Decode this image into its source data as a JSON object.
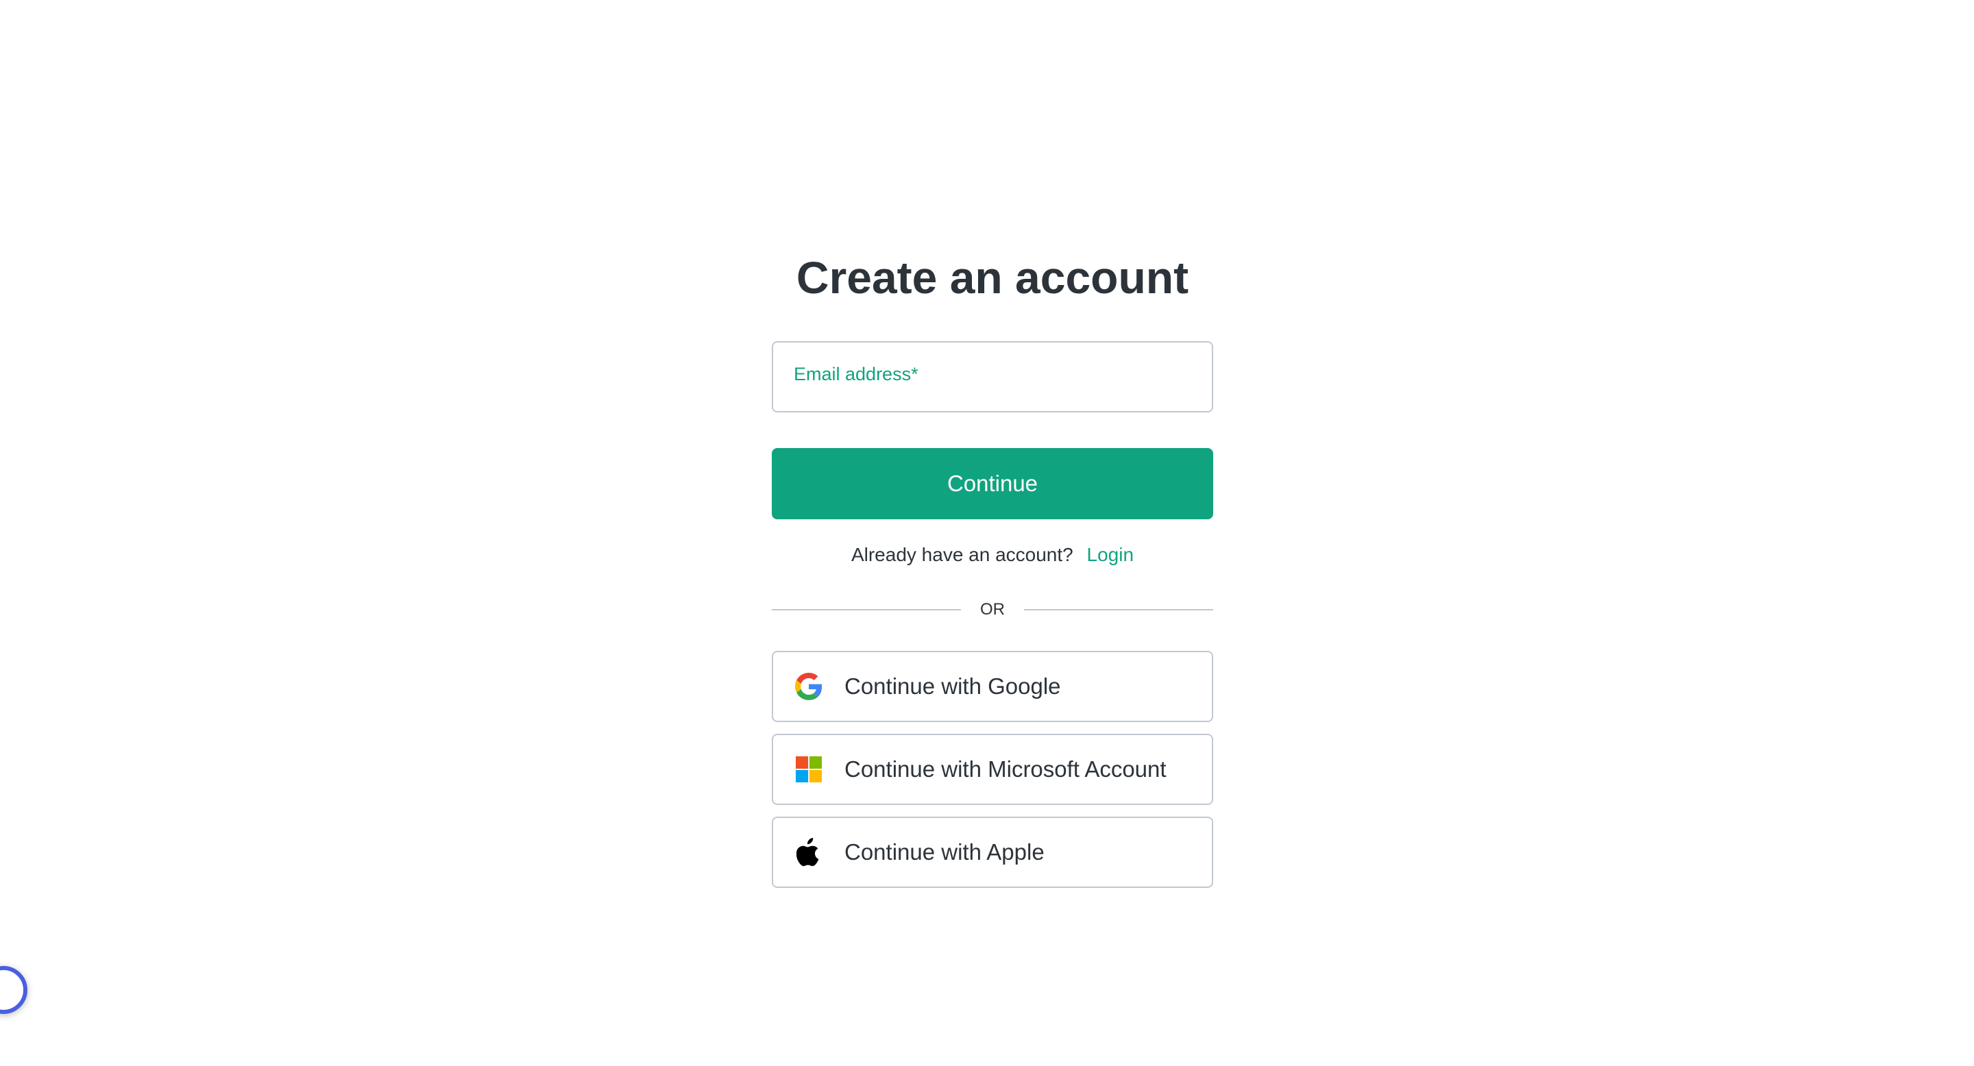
{
  "page": {
    "title": "Create an account"
  },
  "email": {
    "label": "Email address*",
    "value": ""
  },
  "continue": {
    "label": "Continue"
  },
  "login_prompt": {
    "text": "Already have an account?",
    "link": "Login"
  },
  "divider": {
    "text": "OR"
  },
  "social": [
    {
      "label": "Continue with Google",
      "icon": "google-icon"
    },
    {
      "label": "Continue with Microsoft Account",
      "icon": "microsoft-icon"
    },
    {
      "label": "Continue with Apple",
      "icon": "apple-icon"
    }
  ],
  "colors": {
    "accent": "#10a37f",
    "border": "#c2c8d0",
    "text": "#2d333a",
    "assistant_ring": "#4a5fdf"
  }
}
